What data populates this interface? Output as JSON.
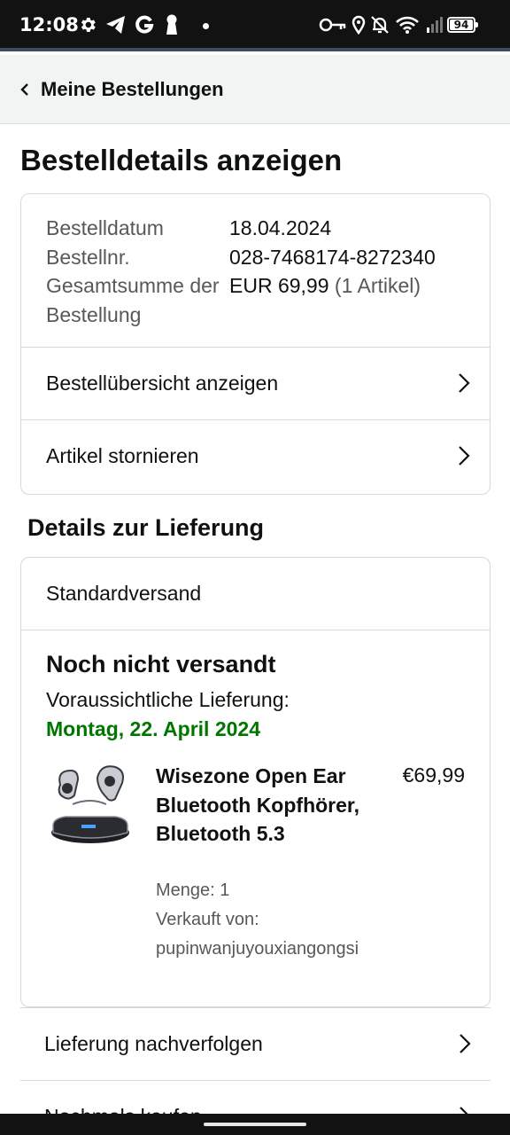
{
  "status_bar": {
    "time": "12:08",
    "battery": "94",
    "left_icons": [
      "gear-icon",
      "telegram-icon",
      "google-icon",
      "keyhole-icon"
    ],
    "right_icons": [
      "key-icon",
      "location-icon",
      "bell-off-icon",
      "wifi-icon",
      "signal-icon"
    ]
  },
  "nav": {
    "back_label": "Meine Bestellungen"
  },
  "page": {
    "title": "Bestelldetails anzeigen"
  },
  "summary": {
    "rows": [
      {
        "label": "Bestelldatum",
        "value": "18.04.2024"
      },
      {
        "label": "Bestellnr.",
        "value": "028-7468174-8272340"
      }
    ],
    "total_label": "Gesamtsumme der Bestellung",
    "total_value": "EUR 69,99",
    "total_count": "(1 Artikel)",
    "links": [
      "Bestellübersicht anzeigen",
      "Artikel stornieren"
    ]
  },
  "delivery": {
    "section_title": "Details zur Lieferung",
    "method": "Standardversand",
    "status": "Noch nicht versandt",
    "estimate_label": "Voraussichtliche Lieferung:",
    "estimate_date": "Montag, 22. April 2024",
    "estimate_color": "#007600",
    "product": {
      "title": "Wisezone Open Ear Bluetooth Kopfhörer, Bluetooth 5.3",
      "price": "€69,99",
      "quantity": "Menge: 1",
      "seller_label": "Verkauft von:",
      "seller": "pupinwanjuyouxiangongsi"
    }
  },
  "actions": [
    "Lieferung nachverfolgen",
    "Nochmals kaufen"
  ]
}
